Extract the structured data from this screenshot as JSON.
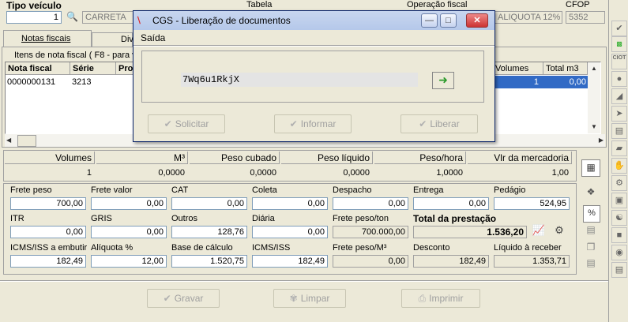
{
  "header": {
    "tipo_veiculo_label": "Tipo veículo",
    "tipo_veiculo_code": "1",
    "tipo_veiculo_name": "CARRETA",
    "tabela_label": "Tabela",
    "operacao_label": "Operação fiscal",
    "operacao_value": "ALIQUOTA 12%",
    "cfop_label": "CFOP",
    "cfop_value": "5352"
  },
  "tabs": [
    "Notas fiscais",
    "Div"
  ],
  "itens": {
    "group_label": "Itens de nota fiscal ( F8 - para vi",
    "columns": [
      "Nota fiscal",
      "Série",
      "Pro"
    ],
    "right_columns": [
      "Volumes",
      "Total m3"
    ],
    "rows": [
      {
        "nota": "0000000131",
        "serie": "3213",
        "volumes": "1",
        "total_m3": "0,00"
      }
    ]
  },
  "summary": {
    "headers": [
      "Volumes",
      "M³",
      "Peso cubado",
      "Peso líquido",
      "Peso/hora",
      "Vlr da mercadoria"
    ],
    "values": [
      "1",
      "0,0000",
      "0,0000",
      "0,0000",
      "1,0000",
      "1,00"
    ]
  },
  "fields": {
    "frete_peso": {
      "label": "Frete peso",
      "value": "700,00"
    },
    "frete_valor": {
      "label": "Frete valor",
      "value": "0,00"
    },
    "cat": {
      "label": "CAT",
      "value": "0,00"
    },
    "coleta": {
      "label": "Coleta",
      "value": "0,00"
    },
    "despacho": {
      "label": "Despacho",
      "value": "0,00"
    },
    "entrega": {
      "label": "Entrega",
      "value": "0,00"
    },
    "pedagio": {
      "label": "Pedágio",
      "value": "524,95"
    },
    "itr": {
      "label": "ITR",
      "value": "0,00"
    },
    "gris": {
      "label": "GRIS",
      "value": "0,00"
    },
    "outros": {
      "label": "Outros",
      "value": "128,76"
    },
    "diaria": {
      "label": "Diária",
      "value": "0,00"
    },
    "frete_peso_ton": {
      "label": "Frete peso/ton",
      "value": "700.000,00"
    },
    "total_prestacao": {
      "label": "Total da prestação",
      "value": "1.536,20"
    },
    "icms_embutir": {
      "label": "ICMS/ISS a embutir",
      "value": "182,49"
    },
    "aliquota": {
      "label": "Alíquota %",
      "value": "12,00"
    },
    "base_calculo": {
      "label": "Base de cálculo",
      "value": "1.520,75"
    },
    "icms_iss": {
      "label": "ICMS/ISS",
      "value": "182,49"
    },
    "frete_peso_m3": {
      "label": "Frete peso/M³",
      "value": "0,00"
    },
    "desconto": {
      "label": "Desconto",
      "value": "182,49"
    },
    "liquido_receber": {
      "label": "Líquido à receber",
      "value": "1.353,71"
    }
  },
  "bottom_buttons": {
    "gravar": "Gravar",
    "limpar": "Limpar",
    "imprimir": "Imprimir"
  },
  "side_toolbar": {
    "ciot": "CIOT"
  },
  "dialog": {
    "title": "CGS - Liberação de documentos",
    "menu": "Saída",
    "code_value": "7Wq6u1RkjX",
    "buttons": {
      "solicitar": "Solicitar",
      "informar": "Informar",
      "liberar": "Liberar"
    }
  },
  "colors": {
    "selection": "#316ac5",
    "dialog_title": "#c8d6ef",
    "go_arrow": "#2a9a2a"
  }
}
